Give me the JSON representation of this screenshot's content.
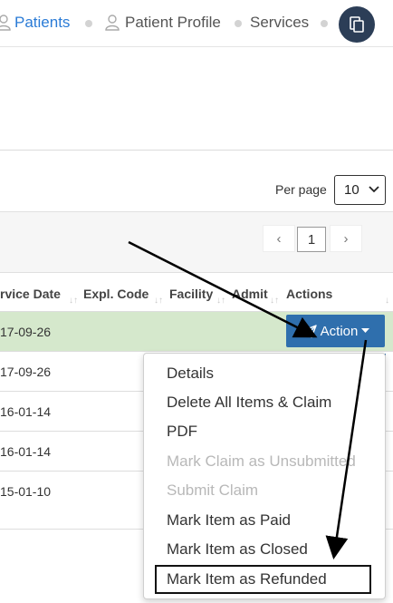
{
  "breadcrumb": {
    "patients": "Patients",
    "patient_profile": "Patient Profile",
    "services": "Services"
  },
  "pagination": {
    "per_page_label": "Per page",
    "per_page_value": "10",
    "prev": "‹",
    "current": "1",
    "next": "›"
  },
  "table": {
    "headers": [
      "rvice Date",
      "Expl. Code",
      "Facility",
      "Admit",
      "Actions"
    ],
    "rows": [
      "17-09-26",
      "17-09-26",
      "16-01-14",
      "16-01-14",
      "15-01-10"
    ]
  },
  "action_button": {
    "label": "Action"
  },
  "dropdown": {
    "items": [
      "Details",
      "Delete All Items & Claim",
      "PDF",
      "Mark Claim as Unsubmitted",
      "Submit Claim",
      "Mark Item as Paid",
      "Mark Item as Closed",
      "Mark Item as Refunded"
    ],
    "disabled_items": [
      "Mark Claim as Unsubmitted",
      "Submit Claim"
    ]
  },
  "colors": {
    "link_blue": "#2a7bd6",
    "action_blue": "#2f6fad",
    "highlight_row": "#d5e8cc",
    "round_button": "#2c3e57"
  },
  "icons": {
    "patients": "user-icon",
    "profile": "user-icon",
    "round_button": "copy-icon",
    "action": "paper-plane-icon"
  }
}
